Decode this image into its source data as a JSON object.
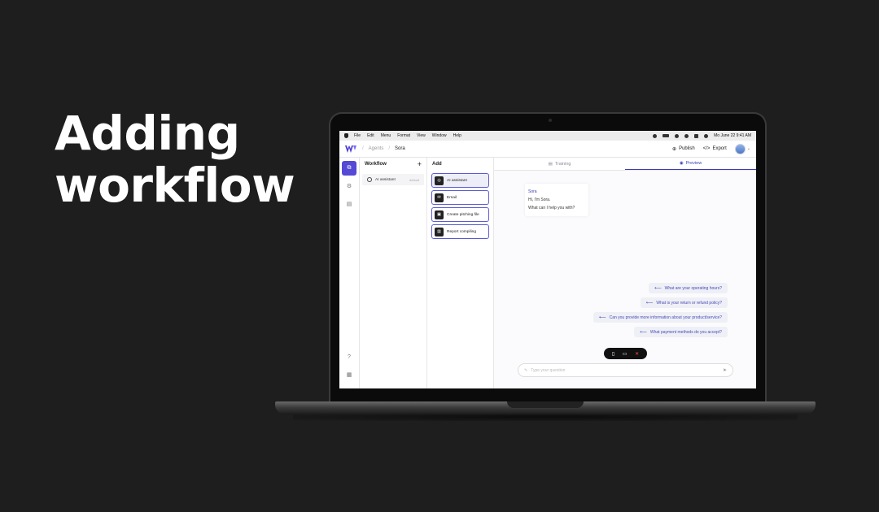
{
  "headline": {
    "line1": "Adding",
    "line2": "workflow"
  },
  "menubar": {
    "items": [
      "File",
      "Edit",
      "Menu",
      "Format",
      "View",
      "Window",
      "Help"
    ],
    "datetime": "Mo June 22  9:41 AM"
  },
  "topbar": {
    "breadcrumb": [
      "Agents",
      "Sora"
    ],
    "publish": "Publish",
    "export": "Export"
  },
  "workflow": {
    "title": "Workflow",
    "items": [
      {
        "label": "AI assistant",
        "tag": "default"
      }
    ]
  },
  "add": {
    "title": "Add",
    "items": [
      "AI assistant",
      "Email",
      "Create pitching file",
      "Report compiling"
    ]
  },
  "tabs": {
    "training": "Training",
    "preview": "Preview"
  },
  "chat": {
    "bot_name": "Sora",
    "line1": "Hi, I'm Sora.",
    "line2": "What can I help you with?"
  },
  "suggestions": [
    "What are your operating hours?",
    "What is your return or refund policy?",
    "Can you provide more information about your product/service?",
    "What payment methods do you accept?"
  ],
  "input": {
    "placeholder": "Type your question"
  },
  "colors": {
    "accent": "#5549d6",
    "background": "#1e1e1e"
  }
}
